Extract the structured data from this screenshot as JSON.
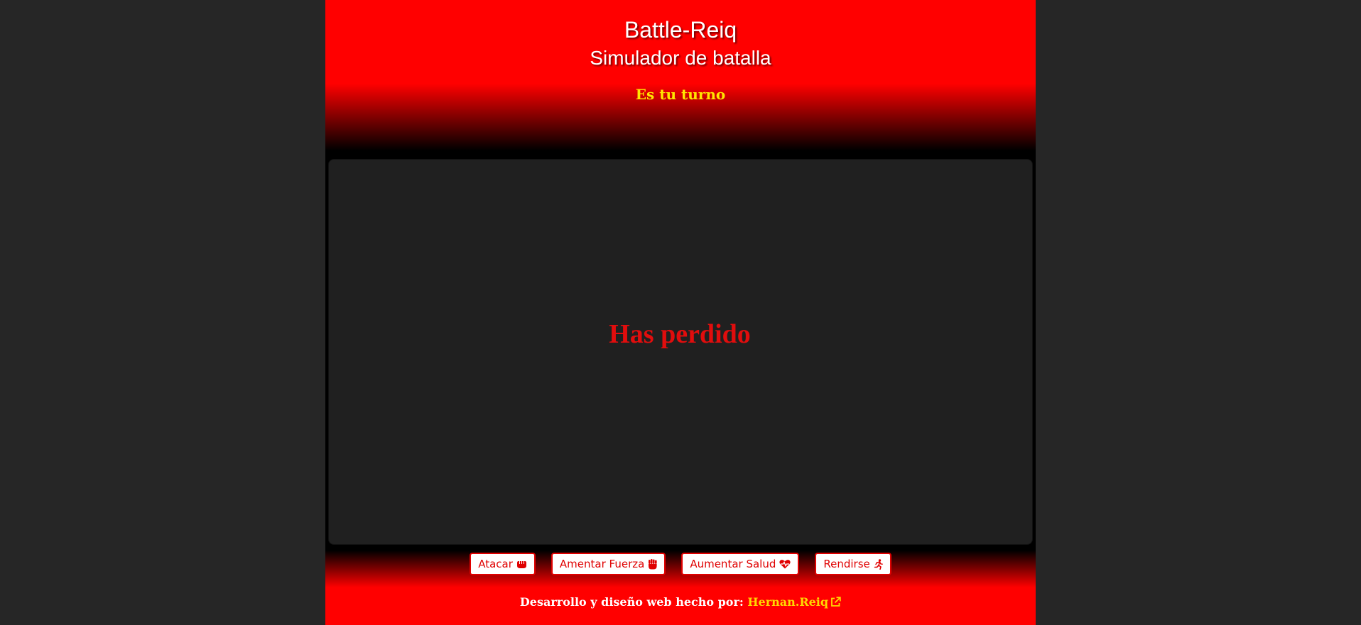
{
  "header": {
    "title": "Battle-Reiq",
    "subtitle": "Simulador de batalla",
    "turn_status": "Es tu turno"
  },
  "arena": {
    "result_message": "Has perdido"
  },
  "actions": [
    {
      "label": "Atacar",
      "icon": "fist-icon"
    },
    {
      "label": "Amentar Fuerza",
      "icon": "raised-fist-icon"
    },
    {
      "label": "Aumentar Salud",
      "icon": "heart-pulse-icon"
    },
    {
      "label": "Rendirse",
      "icon": "running-person-icon"
    }
  ],
  "footer": {
    "credit_text": "Desarrollo y diseño web hecho por:",
    "author_link": "Hernan.Reiq",
    "link_icon": "external-link-icon"
  },
  "colors": {
    "brand_red": "#ff0000",
    "turn_yellow": "#ffe600",
    "result_red": "#e10d0d",
    "page_bg": "#262626",
    "arena_bg": "#202020"
  }
}
